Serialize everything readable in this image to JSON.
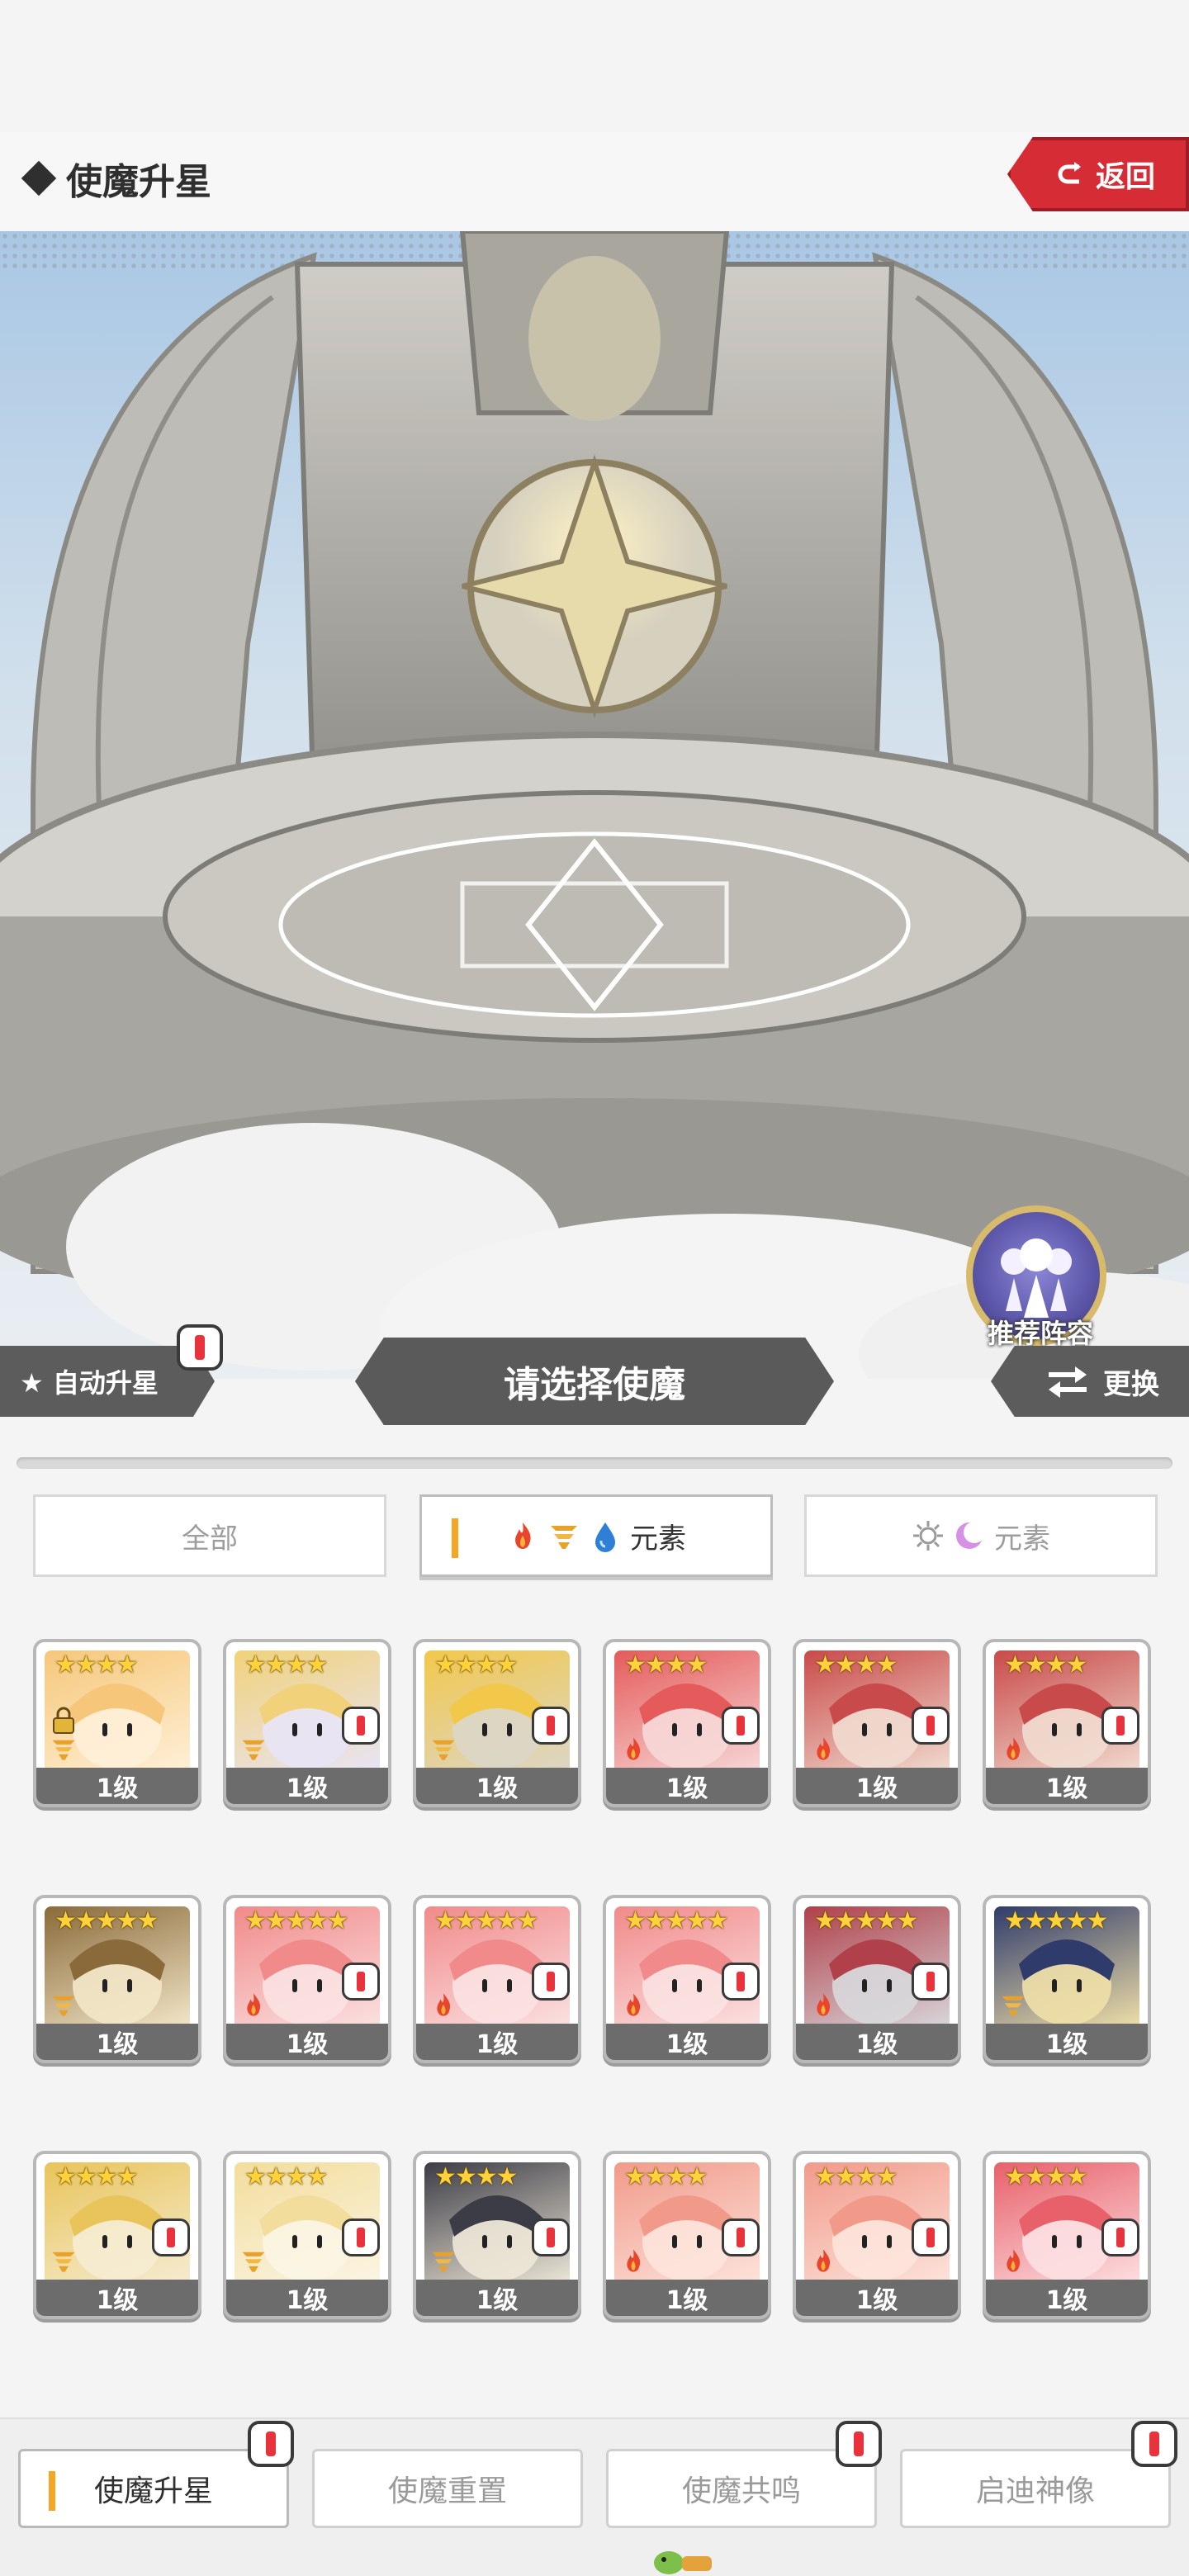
{
  "header": {
    "title": "使魔升星",
    "back_label": "返回"
  },
  "hero": {
    "recommend_label": "推荐阵容"
  },
  "actions": {
    "auto_label": "★ 自动升星",
    "select_label": "请选择使魔",
    "swap_label": "更换"
  },
  "filters": [
    {
      "label": "全部",
      "active": false
    },
    {
      "label": "元素",
      "active": true,
      "icons": [
        "fire-icon",
        "wind-icon",
        "water-icon"
      ]
    },
    {
      "label": "元素",
      "active": false,
      "icons": [
        "light-icon",
        "dark-icon"
      ]
    }
  ],
  "familiars": [
    {
      "stars": "★★★★",
      "level": "1级",
      "element": "wind",
      "locked": true,
      "alert": false,
      "palette": [
        "#f6c77a",
        "#fff0d8"
      ]
    },
    {
      "stars": "★★★★",
      "level": "1级",
      "element": "wind",
      "locked": false,
      "alert": true,
      "palette": [
        "#f1d27a",
        "#e8e4f6"
      ]
    },
    {
      "stars": "★★★★",
      "level": "1级",
      "element": "wind",
      "locked": false,
      "alert": true,
      "palette": [
        "#f2c84b",
        "#dcd6c8"
      ]
    },
    {
      "stars": "★★★★",
      "level": "1级",
      "element": "fire",
      "locked": false,
      "alert": true,
      "palette": [
        "#e55b5b",
        "#f7d8d8"
      ]
    },
    {
      "stars": "★★★★",
      "level": "1级",
      "element": "fire",
      "locked": false,
      "alert": true,
      "palette": [
        "#c94a4a",
        "#f1dcd0"
      ]
    },
    {
      "stars": "★★★★",
      "level": "1级",
      "element": "fire",
      "locked": false,
      "alert": true,
      "palette": [
        "#c94a4a",
        "#f1dcd0"
      ]
    },
    {
      "stars": "★★★★★",
      "level": "1级",
      "element": "wind",
      "locked": false,
      "alert": false,
      "palette": [
        "#8a6a3a",
        "#f3e7c9"
      ]
    },
    {
      "stars": "★★★★★",
      "level": "1级",
      "element": "fire",
      "locked": false,
      "alert": true,
      "palette": [
        "#f18a8a",
        "#fbe2e2"
      ]
    },
    {
      "stars": "★★★★★",
      "level": "1级",
      "element": "fire",
      "locked": false,
      "alert": true,
      "palette": [
        "#f18a8a",
        "#fbe2e2"
      ]
    },
    {
      "stars": "★★★★★",
      "level": "1级",
      "element": "fire",
      "locked": false,
      "alert": true,
      "palette": [
        "#f18a8a",
        "#fbe2e2"
      ]
    },
    {
      "stars": "★★★★★",
      "level": "1级",
      "element": "fire",
      "locked": false,
      "alert": true,
      "palette": [
        "#b0404a",
        "#d8d8dc"
      ]
    },
    {
      "stars": "★★★★★",
      "level": "1级",
      "element": "wind",
      "locked": false,
      "alert": false,
      "palette": [
        "#2f3b6b",
        "#f0e0a8"
      ]
    },
    {
      "stars": "★★★★",
      "level": "1级",
      "element": "wind",
      "locked": false,
      "alert": true,
      "palette": [
        "#e9c45a",
        "#f6ecd2"
      ]
    },
    {
      "stars": "★★★★",
      "level": "1级",
      "element": "wind",
      "locked": false,
      "alert": true,
      "palette": [
        "#f3dd9c",
        "#fbf5e4"
      ]
    },
    {
      "stars": "★★★★",
      "level": "1级",
      "element": "wind",
      "locked": false,
      "alert": true,
      "palette": [
        "#3c3c46",
        "#eee8d8"
      ]
    },
    {
      "stars": "★★★★",
      "level": "1级",
      "element": "fire",
      "locked": false,
      "alert": true,
      "palette": [
        "#f19a8a",
        "#fde4dc"
      ]
    },
    {
      "stars": "★★★★",
      "level": "1级",
      "element": "fire",
      "locked": false,
      "alert": true,
      "palette": [
        "#f19a8a",
        "#fde4dc"
      ]
    },
    {
      "stars": "★★★★",
      "level": "1级",
      "element": "fire",
      "locked": false,
      "alert": true,
      "palette": [
        "#e8606a",
        "#fde0e2"
      ]
    }
  ],
  "bottom_nav": [
    {
      "label": "使魔升星",
      "active": true,
      "alert": true
    },
    {
      "label": "使魔重置",
      "active": false,
      "alert": false
    },
    {
      "label": "使魔共鸣",
      "active": false,
      "alert": true
    },
    {
      "label": "启迪神像",
      "active": false,
      "alert": true
    }
  ],
  "colors": {
    "accent": "#f5a623",
    "back_red": "#d62c36",
    "dark_banner": "#5a5a5a",
    "alert_red": "#e8323c",
    "star": "#ffd23a"
  }
}
